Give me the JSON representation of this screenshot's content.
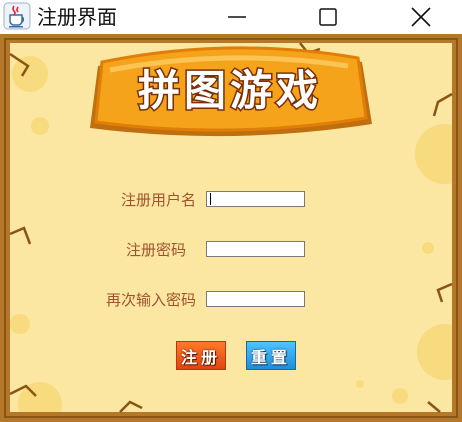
{
  "window": {
    "title": "注册界面",
    "app_icon": "java-cup-icon",
    "controls": [
      "minimize-icon",
      "maximize-icon",
      "close-icon"
    ]
  },
  "banner": {
    "title": "拼图游戏"
  },
  "form": {
    "username_label": "注册用户名",
    "password_label": "注册密码",
    "confirm_label": "再次输入密码",
    "username_value": "",
    "password_value": "",
    "confirm_value": ""
  },
  "buttons": {
    "register_label": "注册",
    "reset_label": "重置"
  },
  "colors": {
    "background": "#fbe7a1",
    "frame": "#b5782b",
    "label_text": "#a0522d",
    "banner_orange": "#f6a31c",
    "register_button": "#e8561a",
    "reset_button": "#2aa2ea"
  }
}
